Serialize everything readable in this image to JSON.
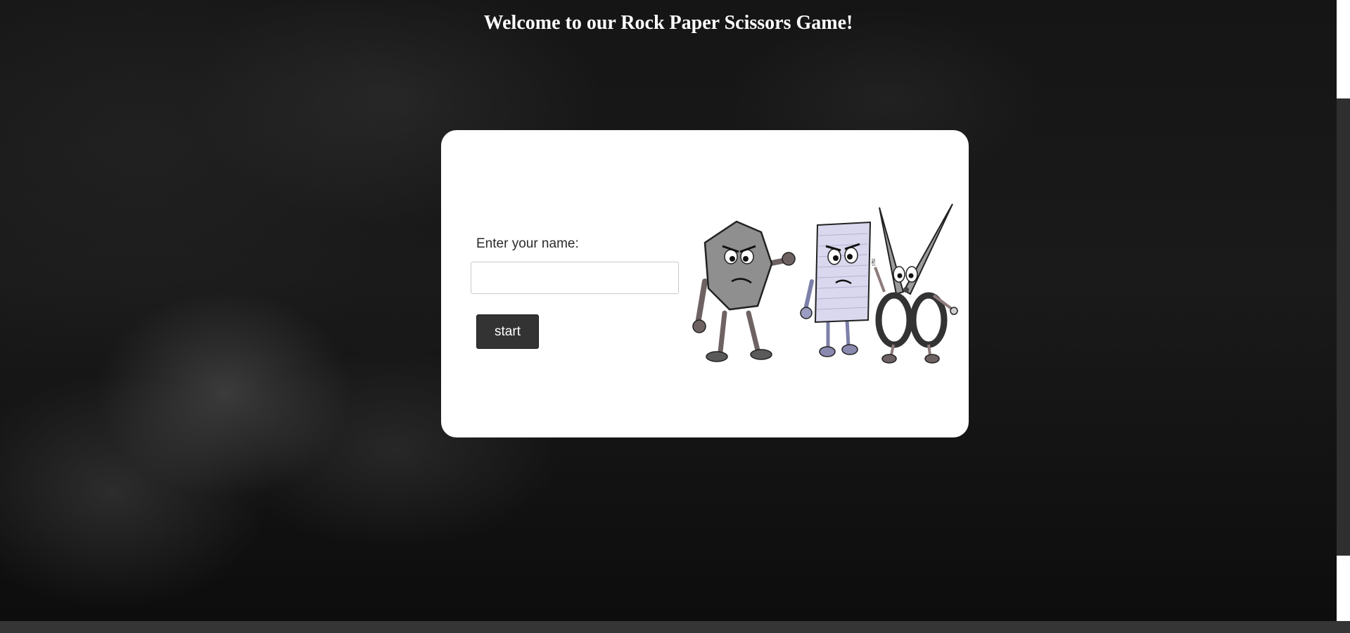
{
  "page": {
    "title": "Welcome to our Rock Paper Scissors Game!"
  },
  "form": {
    "name_label": "Enter your name:",
    "name_value": "",
    "name_placeholder": "",
    "start_label": "start"
  },
  "illustration": {
    "characters": [
      "rock-character",
      "paper-character",
      "scissors-character"
    ]
  },
  "colors": {
    "background": "#151515",
    "card": "#ffffff",
    "button": "#333333",
    "button_text": "#ffffff",
    "title_text": "#ffffff",
    "paper_fill": "#d9d8ee",
    "rock_fill": "#8f8f8f"
  }
}
